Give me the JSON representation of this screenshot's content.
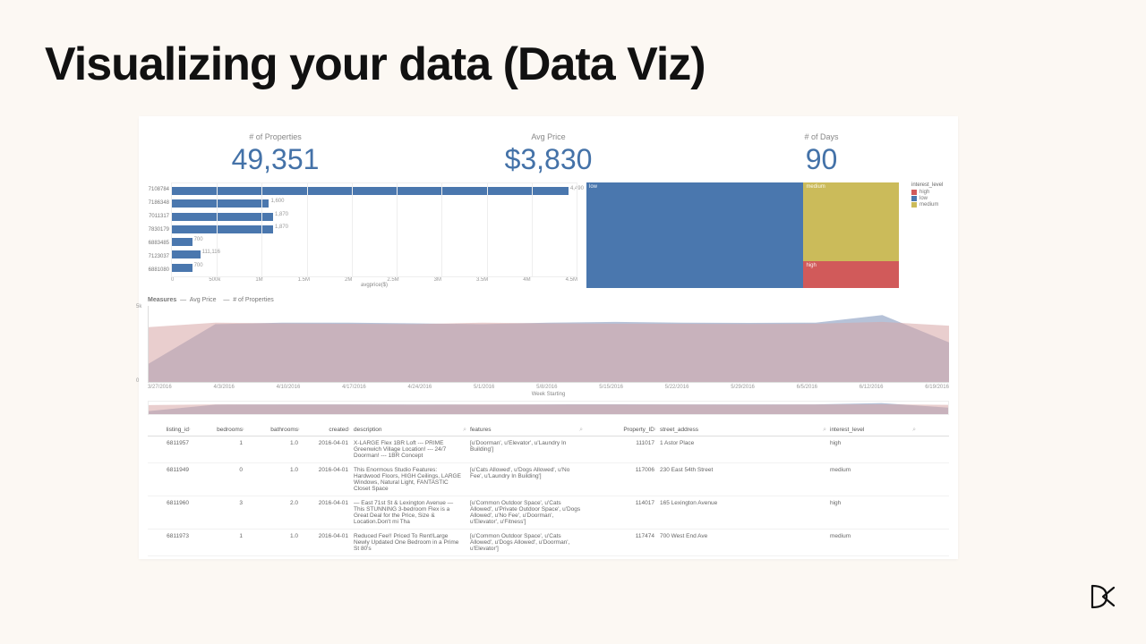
{
  "title": "Visualizing your data (Data Viz)",
  "kpis": [
    {
      "label": "# of Properties",
      "value": "49,351"
    },
    {
      "label": "Avg Price",
      "value": "$3,830"
    },
    {
      "label": "# of Days",
      "value": "90"
    }
  ],
  "chart_data": [
    {
      "type": "bar",
      "orientation": "horizontal",
      "title": "",
      "xlabel": "avgprice($)",
      "categories": [
        "7108784",
        "7186348",
        "7011317",
        "7830179",
        "6883485",
        "7123037",
        "6881080"
      ],
      "values": [
        4490,
        1600,
        1870,
        1870,
        700,
        111116,
        700
      ],
      "value_labels": [
        "4,490",
        "1,600",
        "1,870",
        "1,870",
        "700",
        "111,116",
        "700"
      ],
      "xticks": [
        "0",
        "500k",
        "1M",
        "1.5M",
        "2M",
        "2.5M",
        "3M",
        "3.5M",
        "4M",
        "4.5M"
      ],
      "note": "widths shown are relative within 0–4.5M range"
    },
    {
      "type": "treemap",
      "title": "interest_level",
      "series": [
        {
          "name": "low",
          "value": 34284,
          "color": "#4a77ae"
        },
        {
          "name": "medium",
          "value": 11229,
          "color": "#cbbb5a"
        },
        {
          "name": "high",
          "value": 3839,
          "color": "#d15a5a"
        }
      ],
      "legend": [
        "high",
        "low",
        "medium"
      ]
    },
    {
      "type": "area",
      "title": "",
      "measures": [
        "Avg Price",
        "# of Properties"
      ],
      "xlabel": "Week Starting",
      "x": [
        "3/27/2016",
        "4/3/2016",
        "4/10/2016",
        "4/17/2016",
        "4/24/2016",
        "5/1/2016",
        "5/8/2016",
        "5/15/2016",
        "5/22/2016",
        "5/29/2016",
        "6/5/2016",
        "6/12/2016",
        "6/19/2016"
      ],
      "series": [
        {
          "name": "Avg Price",
          "color": "#d7a6a6",
          "values": [
            3600,
            3900,
            3850,
            3820,
            3800,
            3900,
            3850,
            3830,
            3820,
            3810,
            3830,
            3950,
            3700
          ]
        },
        {
          "name": "# of Properties",
          "color": "#7a8fb8",
          "values": [
            1200,
            3800,
            3900,
            3900,
            3850,
            3800,
            3900,
            3950,
            3900,
            3880,
            3900,
            4400,
            2600
          ]
        }
      ],
      "ylim": [
        0,
        5000
      ],
      "yticks": [
        "5k",
        "0"
      ]
    }
  ],
  "table": {
    "columns": [
      "listing_id",
      "bedrooms",
      "bathrooms",
      "created",
      "description",
      "features",
      "Property_ID",
      "street_address",
      "interest_level"
    ],
    "rows": [
      {
        "listing_id": "6811957",
        "bedrooms": "1",
        "bathrooms": "1.0",
        "created": "2016-04-01",
        "description": "X-LARGE Flex 1BR Loft --- PRIME Greenwich Village Location! --- 24/7 Doorman! --- 1BR Concept",
        "features": "[u'Doorman', u'Elevator', u'Laundry In Building']",
        "Property_ID": "111017",
        "street_address": "1 Astor Place",
        "interest_level": "high"
      },
      {
        "listing_id": "6811949",
        "bedrooms": "0",
        "bathrooms": "1.0",
        "created": "2016-04-01",
        "description": "This Enormous Studio Features: Hardwood Floors, HIGH Ceilings, LARGE Windows, Natural Light, FANTASTIC Closet Space",
        "features": "[u'Cats Allowed', u'Dogs Allowed', u'No Fee', u'Laundry In Building']",
        "Property_ID": "117006",
        "street_address": "230 East 54th Street",
        "interest_level": "medium"
      },
      {
        "listing_id": "6811960",
        "bedrooms": "3",
        "bathrooms": "2.0",
        "created": "2016-04-01",
        "description": "— East 71st St & Lexington Avenue — This STUNNING 3-bedroom Flex is a Great Deal for the Price, Size & Location.Don't mi Tha",
        "features": "[u'Common Outdoor Space', u'Cats Allowed', u'Private Outdoor Space', u'Dogs Allowed', u'No Fee', u'Doorman', u'Elevator', u'Fitness']",
        "Property_ID": "114017",
        "street_address": "165 Lexington Avenue",
        "interest_level": "high"
      },
      {
        "listing_id": "6811973",
        "bedrooms": "1",
        "bathrooms": "1.0",
        "created": "2016-04-01",
        "description": "Reduced Fee!! Priced To Rent!Large Newly Updated One Bedroom in a Prime St 80's",
        "features": "[u'Common Outdoor Space', u'Cats Allowed', u'Dogs Allowed', u'Doorman', u'Elevator']",
        "Property_ID": "117474",
        "street_address": "700 West End Ave",
        "interest_level": "medium"
      }
    ]
  },
  "logo": "DC"
}
